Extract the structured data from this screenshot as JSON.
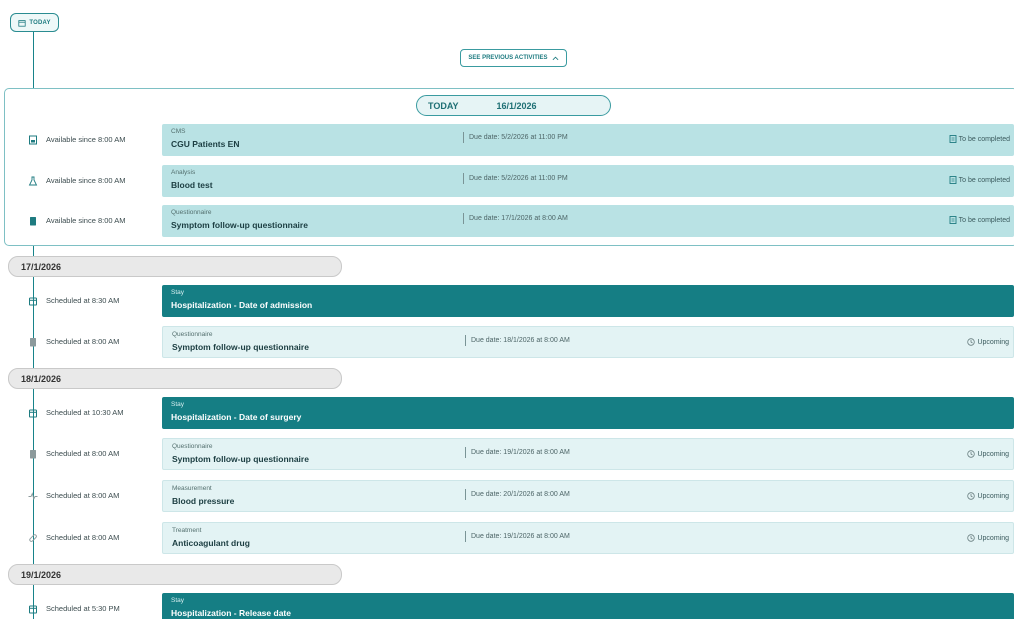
{
  "today_button": {
    "label": "TODAY",
    "icon": "calendar-icon"
  },
  "see_previous": {
    "label": "SEE PREVIOUS ACTIVITIES",
    "icon": "chevron-up-icon"
  },
  "today_section": {
    "label": "TODAY",
    "date": "16/1/2026",
    "items": [
      {
        "icon": "document-icon",
        "time": "Available since 8:00 AM",
        "category": "CMS",
        "title": "CGU Patients EN",
        "due": "Due date: 5/2/2026 at 11:00 PM",
        "status": "To be completed",
        "status_icon": "file-icon"
      },
      {
        "icon": "flask-icon",
        "time": "Available since 8:00 AM",
        "category": "Analysis",
        "title": "Blood test",
        "due": "Due date: 5/2/2026 at 11:00 PM",
        "status": "To be completed",
        "status_icon": "file-icon"
      },
      {
        "icon": "clipboard-icon",
        "time": "Available since 8:00 AM",
        "category": "Questionnaire",
        "title": "Symptom follow-up questionnaire",
        "due": "Due date: 17/1/2026 at 8:00 AM",
        "status": "To be completed",
        "status_icon": "file-icon"
      }
    ]
  },
  "days": [
    {
      "date": "17/1/2026",
      "items": [
        {
          "icon": "calendar-icon",
          "time": "Scheduled at 8:30 AM",
          "category": "Stay",
          "title": "Hospitalization - Date of admission"
        },
        {
          "icon": "clipboard-icon",
          "time": "Scheduled at 8:00 AM",
          "category": "Questionnaire",
          "title": "Symptom follow-up questionnaire",
          "due": "Due date: 18/1/2026 at 8:00 AM",
          "status": "Upcoming",
          "status_icon": "clock-icon"
        }
      ]
    },
    {
      "date": "18/1/2026",
      "items": [
        {
          "icon": "calendar-icon",
          "time": "Scheduled at 10:30 AM",
          "category": "Stay",
          "title": "Hospitalization - Date of surgery"
        },
        {
          "icon": "clipboard-icon",
          "time": "Scheduled at 8:00 AM",
          "category": "Questionnaire",
          "title": "Symptom follow-up questionnaire",
          "due": "Due date: 19/1/2026 at 8:00 AM",
          "status": "Upcoming",
          "status_icon": "clock-icon"
        },
        {
          "icon": "pulse-icon",
          "time": "Scheduled at 8:00 AM",
          "category": "Measurement",
          "title": "Blood pressure",
          "due": "Due date: 20/1/2026 at 8:00 AM",
          "status": "Upcoming",
          "status_icon": "clock-icon"
        },
        {
          "icon": "pill-icon",
          "time": "Scheduled at 8:00 AM",
          "category": "Treatment",
          "title": "Anticoagulant drug",
          "due": "Due date: 19/1/2026 at 8:00 AM",
          "status": "Upcoming",
          "status_icon": "clock-icon"
        }
      ]
    },
    {
      "date": "19/1/2026",
      "items": [
        {
          "icon": "calendar-icon",
          "time": "Scheduled at 5:30 PM",
          "category": "Stay",
          "title": "Hospitalization - Release date"
        }
      ]
    }
  ],
  "colors": {
    "accent": "#157e84",
    "today_card": "#b9e2e4",
    "upcoming_card": "#e3f3f4",
    "date_pill": "#e9e9e9"
  }
}
